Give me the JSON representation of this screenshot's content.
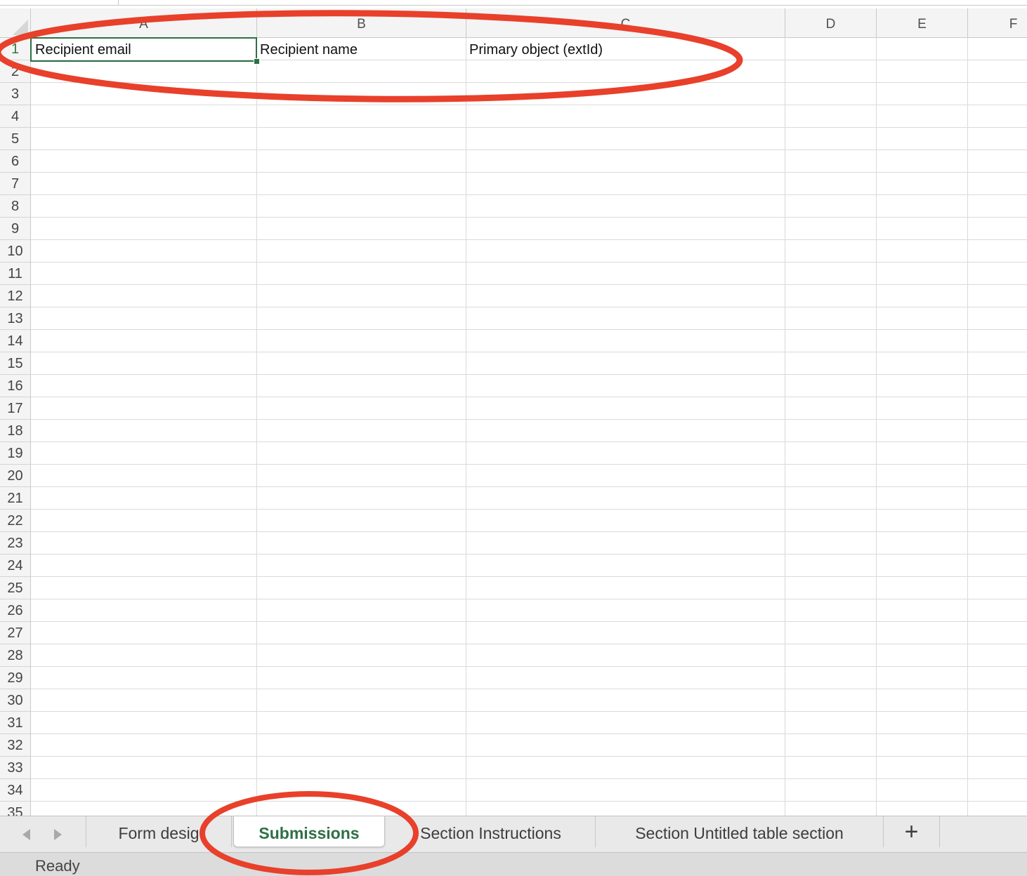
{
  "columns": [
    "A",
    "B",
    "C",
    "D",
    "E",
    "F"
  ],
  "rows": [
    "1",
    "2",
    "3",
    "4",
    "5",
    "6",
    "7",
    "8",
    "9",
    "10",
    "11",
    "12",
    "13",
    "14",
    "15",
    "16",
    "17",
    "18",
    "19",
    "20",
    "21",
    "22",
    "23",
    "24",
    "25",
    "26",
    "27",
    "28",
    "29",
    "30",
    "31",
    "32",
    "33",
    "34",
    "35"
  ],
  "cells": {
    "A1": "Recipient email",
    "B1": "Recipient name",
    "C1": "Primary object (extId)"
  },
  "tabs": [
    "Form desig",
    "Submissions",
    "Section Instructions",
    "Section Untitled table section"
  ],
  "active_tab": "Submissions",
  "add_sheet_icon": "+",
  "status": "Ready",
  "colors": {
    "accent_green": "#2e7045",
    "annotation_red": "#e8402a"
  }
}
